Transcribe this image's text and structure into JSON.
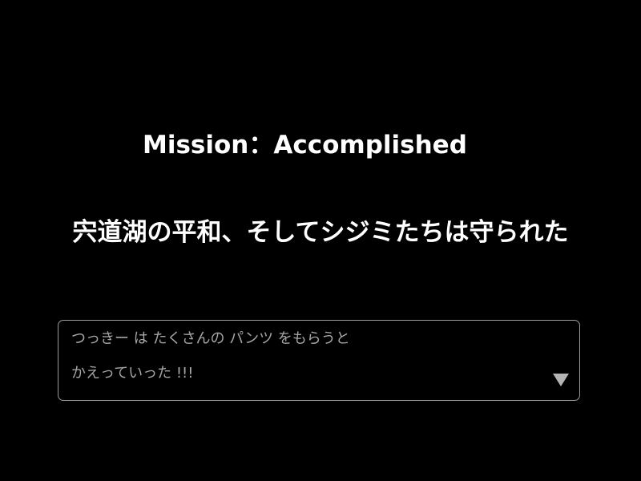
{
  "screen": {
    "mission_title": "Mission：Accomplished",
    "subtitle": "宍道湖の平和、そしてシジミたちは守られた"
  },
  "message_window": {
    "lines": [
      "つっきー は たくさんの パンツ をもらうと",
      "かえっていった !!!"
    ],
    "advance_icon": "triangle-down-icon"
  },
  "colors": {
    "background": "#000000",
    "title_text": "#ffffff",
    "message_text": "#a6a6a6",
    "window_border": "#9a9a9a"
  }
}
